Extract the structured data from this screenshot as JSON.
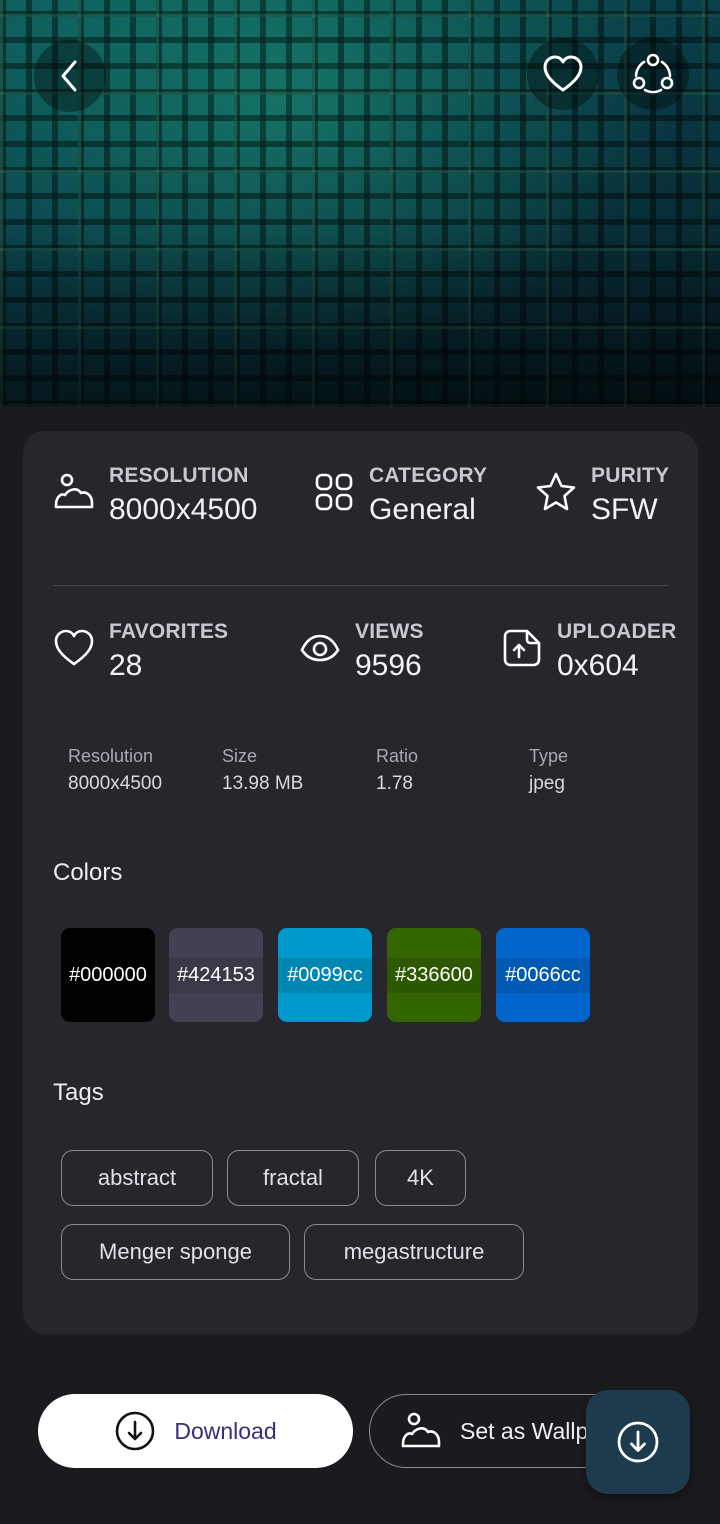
{
  "stats": {
    "resolution": {
      "label": "RESOLUTION",
      "value": "8000x4500",
      "icon": "landscape-icon"
    },
    "category": {
      "label": "CATEGORY",
      "value": "General",
      "icon": "grid-icon"
    },
    "purity": {
      "label": "PURITY",
      "value": "SFW",
      "icon": "star-icon"
    },
    "favorites": {
      "label": "FAVORITES",
      "value": "28",
      "icon": "heart-icon"
    },
    "views": {
      "label": "VIEWS",
      "value": "9596",
      "icon": "eye-icon"
    },
    "uploader": {
      "label": "UPLOADER",
      "value": "0x604",
      "icon": "upload-icon"
    }
  },
  "details": [
    {
      "label": "Resolution",
      "value": "8000x4500"
    },
    {
      "label": "Size",
      "value": "13.98 MB"
    },
    {
      "label": "Ratio",
      "value": "1.78"
    },
    {
      "label": "Type",
      "value": "jpeg"
    }
  ],
  "colors_title": "Colors",
  "colors": [
    "#000000",
    "#424153",
    "#0099cc",
    "#336600",
    "#0066cc"
  ],
  "tags_title": "Tags",
  "tags": [
    "abstract",
    "fractal",
    "4K",
    "Menger sponge",
    "megastructure"
  ],
  "actions": {
    "download": "Download",
    "set_wallpaper": "Set as Wallp"
  }
}
